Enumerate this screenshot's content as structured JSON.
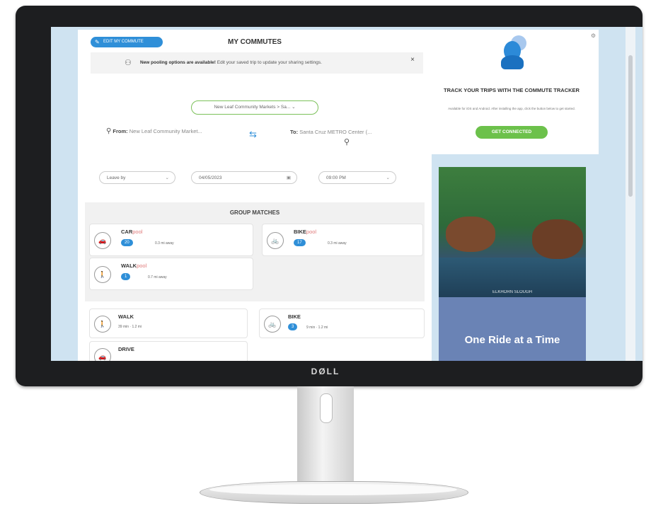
{
  "monitor": {
    "brand": "DØLL"
  },
  "app": {
    "edit_button_label": "EDIT MY COMMUTE",
    "title": "MY COMMUTES",
    "notice": {
      "bold": "New pooling options are available!",
      "text": "Edit your saved trip to update your sharing settings.",
      "close": "×"
    },
    "route_select": "New Leaf Community Markets > Sa...",
    "from": {
      "label": "From:",
      "value": "New Leaf Community Market..."
    },
    "to": {
      "label": "To:",
      "value": "Santa Cruz METRO Center (..."
    },
    "leave_by": "Leave by",
    "date": "04/05/2023",
    "time": "09:00 PM",
    "group_matches_title": "GROUP MATCHES",
    "group": [
      {
        "name": "CAR",
        "suffix": "pool",
        "count": "20",
        "distance": "0.3 mi away"
      },
      {
        "name": "BIKE",
        "suffix": "pool",
        "count": "17",
        "distance": "0.3 mi away"
      },
      {
        "name": "WALK",
        "suffix": "pool",
        "count": "1",
        "distance": "0.7 mi away"
      }
    ],
    "modes": [
      {
        "name": "WALK",
        "meta": "39 min · 1.2 mi"
      },
      {
        "name": "BIKE",
        "badge": "3",
        "meta": "9 min · 1.2 mi"
      },
      {
        "name": "DRIVE"
      }
    ]
  },
  "tracker": {
    "title": "TRACK YOUR TRIPS WITH THE COMMUTE TRACKER",
    "subtitle": "Available for iOS and Android. After installing the app, click the button below to get started.",
    "button": "GET CONNECTED"
  },
  "ad": {
    "location": "ELKHORN SLOUGH",
    "headline": "One Ride at a Time"
  }
}
